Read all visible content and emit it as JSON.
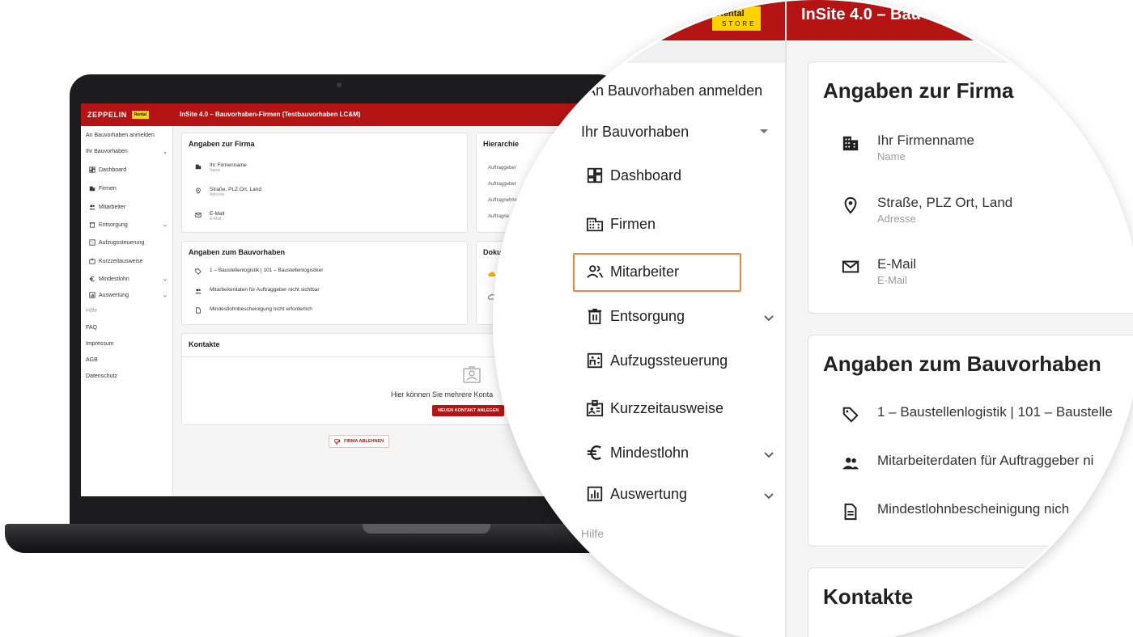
{
  "app": {
    "brand": "ZEPPELIN",
    "brand_partner": "Rental",
    "brand_partner_sub": "STORE",
    "title": "InSite 4.0 – Bauvorhaben-Firmen (Testbauvorhaben LC&M)",
    "title_zoom": "InSite 4.0 – Bau",
    "accent_color": "#b51414"
  },
  "sidebar": {
    "register": "An Bauvorhaben anmelden",
    "project": "Ihr Bauvorhaben",
    "items": [
      {
        "label": "Dashboard",
        "icon": "dashboard-icon"
      },
      {
        "label": "Firmen",
        "icon": "building-icon"
      },
      {
        "label": "Mitarbeiter",
        "icon": "people-icon"
      },
      {
        "label": "Entsorgung",
        "icon": "trash-icon"
      },
      {
        "label": "Aufzugssteuerung",
        "icon": "elevator-icon"
      },
      {
        "label": "Kurzzeitausweise",
        "icon": "badge-icon"
      },
      {
        "label": "Mindestlohn",
        "icon": "euro-icon"
      },
      {
        "label": "Auswertung",
        "icon": "chart-icon"
      }
    ],
    "help_label": "Hilfe",
    "links": [
      "FAQ",
      "Impressum",
      "AGB",
      "Datenschutz"
    ]
  },
  "firma": {
    "title": "Angaben zur Firma",
    "name": "Ihr Firmenname",
    "name_label": "Name",
    "address": "Straße, PLZ Ort, Land",
    "address_label": "Adresse",
    "email": "E-Mail",
    "email_label": "E-Mail"
  },
  "hierarchie": {
    "title": "Hierarchie",
    "rows": [
      "Auftraggeber",
      "Auftraggeber",
      "Auftragnehme",
      "Auftragne"
    ]
  },
  "bauvorhaben": {
    "title": "Angaben zum Bauvorhaben",
    "rows": [
      "1 – Baustellenlogistik | 101 – Baustellenlogistiker",
      "Mitarbeiterdaten für Auftraggeber nicht sichtbar",
      "Mindestlohnbescheinigung nicht erforderlich"
    ],
    "rows_zoom": [
      "1 – Baustellenlogistik | 101 – Baustelle",
      "Mitarbeiterdaten für Auftraggeber ni",
      "Mindestlohnbescheinigung nich"
    ]
  },
  "dokumente": {
    "title": "Doku"
  },
  "kontakte": {
    "title": "Kontakte",
    "empty_text": "Hier können Sie mehrere Konta",
    "add_button": "NEUEN KONTAKT ANLEGEN"
  },
  "actions": {
    "reject_firm": "FIRMA ABLEHNEN"
  },
  "zoom": {
    "highlighted_item": "Mitarbeiter"
  }
}
